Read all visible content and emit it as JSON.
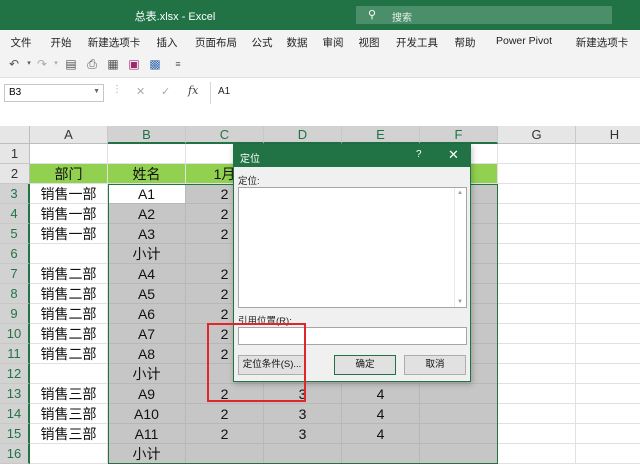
{
  "window": {
    "title": "总表.xlsx  -  Excel",
    "search_placeholder": "搜索"
  },
  "ribbon_tabs": [
    "文件",
    "开始",
    "新建选项卡",
    "插入",
    "页面布局",
    "公式",
    "数据",
    "审阅",
    "视图",
    "开发工具",
    "帮助",
    "Power Pivot",
    "新建选项卡"
  ],
  "formula_bar": {
    "name_box": "B3",
    "fx_label": "fx",
    "value": "A1"
  },
  "columns": [
    "A",
    "B",
    "C",
    "D",
    "E",
    "F",
    "G",
    "H"
  ],
  "rows": [
    "1",
    "2",
    "3",
    "4",
    "5",
    "6",
    "7",
    "8",
    "9",
    "10",
    "11",
    "12",
    "13",
    "14",
    "15",
    "16"
  ],
  "cells": {
    "A2": "部门",
    "B2": "姓名",
    "C2": "1月",
    "A3": "销售一部",
    "B3": "A1",
    "C3": "2",
    "A4": "销售一部",
    "B4": "A2",
    "C4": "2",
    "A5": "销售一部",
    "B5": "A3",
    "C5": "2",
    "B6": "小计",
    "A7": "销售二部",
    "B7": "A4",
    "C7": "2",
    "A8": "销售二部",
    "B8": "A5",
    "C8": "2",
    "A9": "销售二部",
    "B9": "A6",
    "C9": "2",
    "A10": "销售二部",
    "B10": "A7",
    "C10": "2",
    "A11": "销售二部",
    "B11": "A8",
    "C11": "2",
    "B12": "小计",
    "A13": "销售三部",
    "B13": "A9",
    "C13": "2",
    "D13": "3",
    "E13": "4",
    "A14": "销售三部",
    "B14": "A10",
    "C14": "2",
    "D14": "3",
    "E14": "4",
    "A15": "销售三部",
    "B15": "A11",
    "C15": "2",
    "D15": "3",
    "E15": "4",
    "B16": "小计"
  },
  "dialog": {
    "title": "定位",
    "help": "?",
    "close": "✕",
    "goto_label": "定位:",
    "reference_label": "引用位置(R):",
    "reference_value": "",
    "special_button": "定位条件(S)...",
    "ok_button": "确定",
    "cancel_button": "取消"
  },
  "colors": {
    "accent": "#217346",
    "header_fill": "#92d050",
    "annotation": "#e0262a"
  }
}
